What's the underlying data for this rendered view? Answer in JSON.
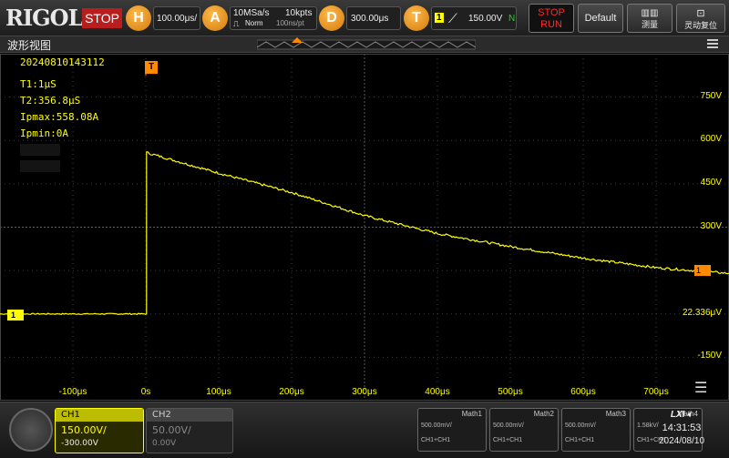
{
  "topbar": {
    "logo": "RIGOL",
    "status": "STOP",
    "horizontal": {
      "key": "H",
      "value": "100.00μs/"
    },
    "acquire": {
      "key": "A",
      "rate": "10MSa/s",
      "mode": "Norm",
      "points": "10kpts",
      "per_point": "100ns/pt"
    },
    "delay": {
      "key": "D",
      "value": "300.00μs"
    },
    "trigger": {
      "key": "T",
      "source": "1",
      "level": "150.00V",
      "coupling": "N"
    },
    "run_stop": {
      "line1": "STOP",
      "line2": "RUN"
    },
    "default_button": "Default",
    "measure_button": "测量",
    "autoset_button": "灵动复位"
  },
  "window": {
    "title": "波形视图"
  },
  "annotations": {
    "timestamp": "20240810143112",
    "t1": "T1:1μS",
    "t2": "T2:356.8μS",
    "ipmax": "Ipmax:558.08A",
    "ipmin": "Ipmin:0A"
  },
  "markers": {
    "trigger": "T",
    "channel1": "1",
    "trigger_level": "1"
  },
  "y_axis": {
    "labels": [
      {
        "text": "750V",
        "value": 750
      },
      {
        "text": "600V",
        "value": 600
      },
      {
        "text": "450V",
        "value": 450
      },
      {
        "text": "300V",
        "value": 300
      },
      {
        "text": "22.336μV",
        "value": 0
      },
      {
        "text": "-150V",
        "value": -150
      }
    ]
  },
  "x_axis": {
    "labels": [
      {
        "text": "-100μs",
        "value": -100
      },
      {
        "text": "0s",
        "value": 0
      },
      {
        "text": "100μs",
        "value": 100
      },
      {
        "text": "200μs",
        "value": 200
      },
      {
        "text": "300μs",
        "value": 300
      },
      {
        "text": "400μs",
        "value": 400
      },
      {
        "text": "500μs",
        "value": 500
      },
      {
        "text": "600μs",
        "value": 600
      },
      {
        "text": "700μs",
        "value": 700
      }
    ]
  },
  "waveform": {
    "color": "#ffff00",
    "x_range_us": [
      -200,
      800
    ],
    "y_range_v": [
      -300,
      900
    ],
    "pre_trigger_level_v": 0,
    "peak_time_us": 1,
    "peak_v": 558,
    "decay_points": [
      {
        "t": 1,
        "v": 558
      },
      {
        "t": 100,
        "v": 487
      },
      {
        "t": 200,
        "v": 420
      },
      {
        "t": 300,
        "v": 340
      },
      {
        "t": 400,
        "v": 278
      },
      {
        "t": 500,
        "v": 233
      },
      {
        "t": 600,
        "v": 193
      },
      {
        "t": 700,
        "v": 160
      },
      {
        "t": 800,
        "v": 140
      }
    ]
  },
  "channels": [
    {
      "name": "CH1",
      "scale": "150.00V/",
      "offset": "-300.00V",
      "active": true,
      "color": "#ffff00"
    },
    {
      "name": "CH2",
      "scale": "50.00V/",
      "offset": "0.00V",
      "active": false,
      "color": "#888888"
    }
  ],
  "math": [
    {
      "name": "Math1",
      "scale": "500.00mV/",
      "source": "CH1+CH1"
    },
    {
      "name": "Math2",
      "scale": "500.00mV/",
      "source": "CH1+CH1"
    },
    {
      "name": "Math3",
      "scale": "500.00mV/",
      "source": "CH1+CH1"
    },
    {
      "name": "Math4",
      "scale": "1.58kV/",
      "source": "CH1+CH1"
    }
  ],
  "status": {
    "lxi": "LXI",
    "time": "14:31:53",
    "date": "2024/08/10"
  }
}
